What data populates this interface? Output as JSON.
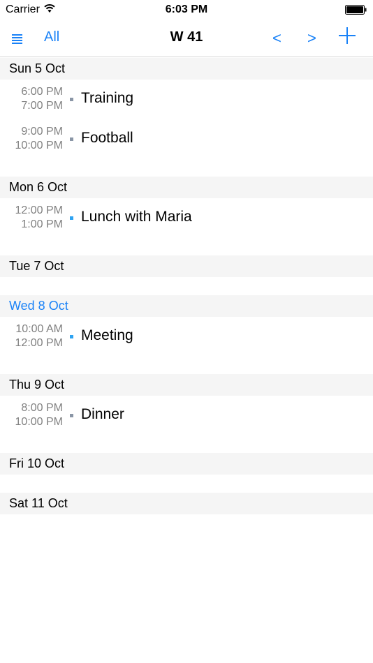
{
  "status_bar": {
    "carrier": "Carrier",
    "time": "6:03 PM"
  },
  "nav": {
    "all_label": "All",
    "title": "W 41",
    "prev_label": "<",
    "next_label": ">"
  },
  "colors": {
    "accent": "#1a82f7",
    "dot_gray": "#8a96a6",
    "dot_blue": "#2ea3f2"
  },
  "days": [
    {
      "label": "Sun 5 Oct",
      "today": false,
      "events": [
        {
          "start": "6:00 PM",
          "end": "7:00 PM",
          "title": "Training",
          "color": "#8a96a6"
        },
        {
          "start": "9:00 PM",
          "end": "10:00 PM",
          "title": "Football",
          "color": "#8a96a6"
        }
      ]
    },
    {
      "label": "Mon 6 Oct",
      "today": false,
      "events": [
        {
          "start": "12:00 PM",
          "end": "1:00 PM",
          "title": "Lunch with Maria",
          "color": "#2ea3f2"
        }
      ]
    },
    {
      "label": "Tue 7 Oct",
      "today": false,
      "events": []
    },
    {
      "label": "Wed 8 Oct",
      "today": true,
      "events": [
        {
          "start": "10:00 AM",
          "end": "12:00 PM",
          "title": "Meeting",
          "color": "#2ea3f2"
        }
      ]
    },
    {
      "label": "Thu 9 Oct",
      "today": false,
      "events": [
        {
          "start": "8:00 PM",
          "end": "10:00 PM",
          "title": "Dinner",
          "color": "#8a96a6"
        }
      ]
    },
    {
      "label": "Fri 10 Oct",
      "today": false,
      "events": []
    },
    {
      "label": "Sat 11 Oct",
      "today": false,
      "events": []
    }
  ]
}
